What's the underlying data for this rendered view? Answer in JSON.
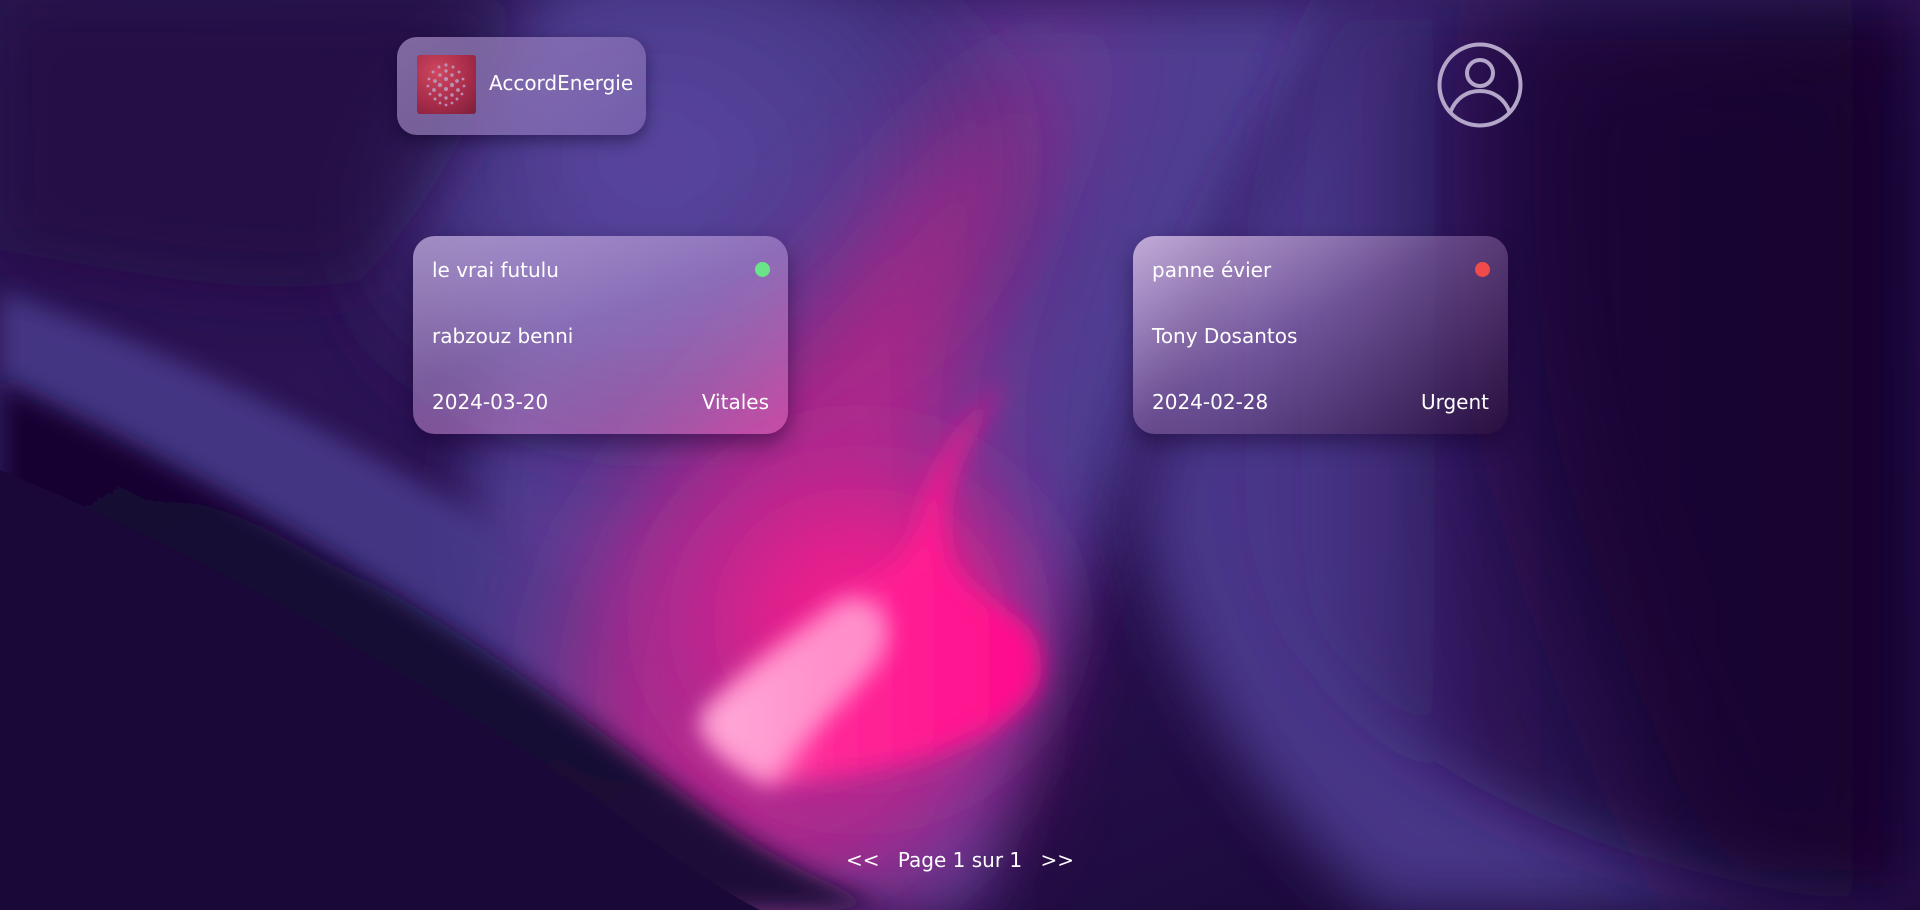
{
  "header": {
    "brand_name": "AccordEnergie",
    "logo_icon": "sphere-logo-icon",
    "profile_icon": "user-avatar-icon"
  },
  "cards": [
    {
      "title": "le vrai futulu",
      "person": "rabzouz benni",
      "date": "2024-03-20",
      "category": "Vitales",
      "status_color": "#6be389"
    },
    {
      "title": "panne évier",
      "person": "Tony Dosantos",
      "date": "2024-02-28",
      "category": "Urgent",
      "status_color": "#f04a4a"
    }
  ],
  "pagination": {
    "prev": "<<",
    "label": "Page 1 sur 1",
    "next": ">>"
  },
  "colors": {
    "background_dark": "#1a0838",
    "accent_pink": "#ff0a8c",
    "accent_purple": "#52408f"
  }
}
